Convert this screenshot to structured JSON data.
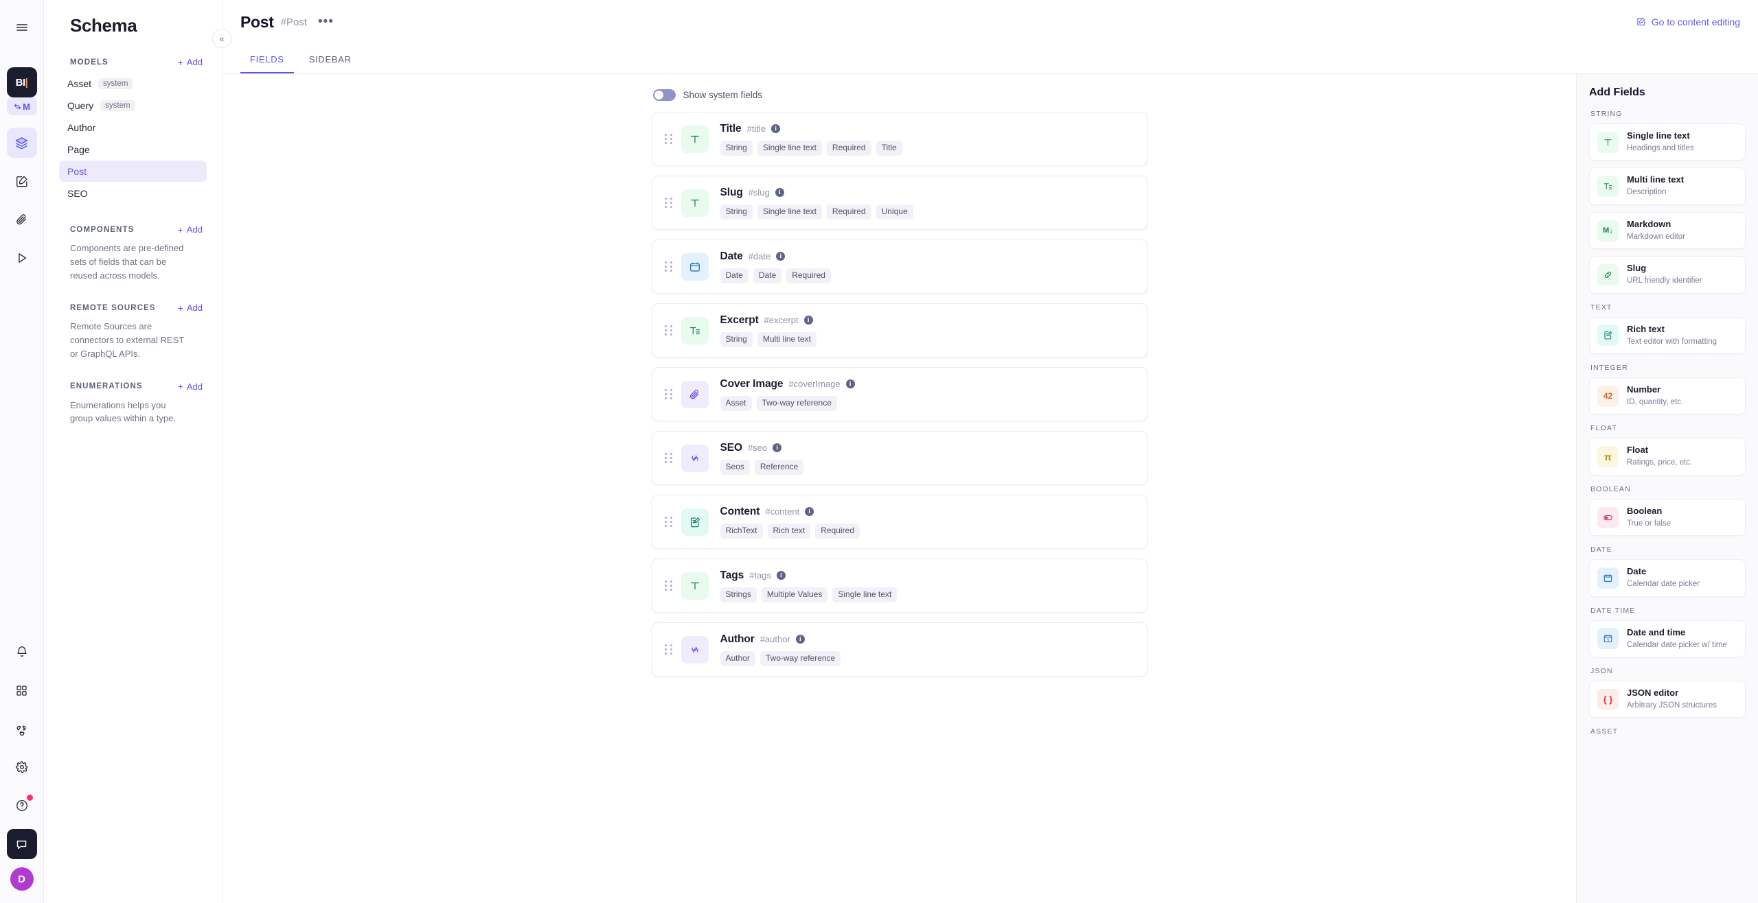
{
  "rail": {
    "menu_icon": "hamburger-menu-icon",
    "logo_text": "BI",
    "project_text": "M",
    "items": [
      {
        "name": "layers-icon",
        "active": true
      },
      {
        "name": "edit-square-icon",
        "active": false
      },
      {
        "name": "paperclip-icon",
        "active": false
      },
      {
        "name": "play-triangle-icon",
        "active": false
      }
    ],
    "bottom_items": [
      {
        "name": "bell-icon"
      },
      {
        "name": "grid-apps-icon"
      },
      {
        "name": "webhook-icon"
      },
      {
        "name": "gear-icon"
      },
      {
        "name": "help-circle-icon",
        "badge": true
      },
      {
        "name": "chat-bubble-icon",
        "dark": true
      }
    ],
    "avatar_initial": "D"
  },
  "sidebar": {
    "title": "Schema",
    "collapse_icon": "chevrons-left-icon",
    "models": {
      "heading": "MODELS",
      "add_label": "Add",
      "items": [
        {
          "label": "Asset",
          "badge": "system",
          "active": false
        },
        {
          "label": "Query",
          "badge": "system",
          "active": false
        },
        {
          "label": "Author",
          "badge": "",
          "active": false
        },
        {
          "label": "Page",
          "badge": "",
          "active": false
        },
        {
          "label": "Post",
          "badge": "",
          "active": true
        },
        {
          "label": "SEO",
          "badge": "",
          "active": false
        }
      ]
    },
    "components": {
      "heading": "COMPONENTS",
      "add_label": "Add",
      "description": "Components are pre-defined sets of fields that can be reused across models."
    },
    "remote_sources": {
      "heading": "REMOTE SOURCES",
      "add_label": "Add",
      "description": "Remote Sources are connectors to external REST or GraphQL APIs."
    },
    "enumerations": {
      "heading": "ENUMERATIONS",
      "add_label": "Add",
      "description": "Enumerations helps you group values within a type."
    }
  },
  "header": {
    "title": "Post",
    "api_id": "#Post",
    "more_label": "•••",
    "goto_label": "Go to content editing",
    "goto_icon": "edit-square-icon"
  },
  "tabs": [
    {
      "label": "FIELDS",
      "active": true
    },
    {
      "label": "SIDEBAR",
      "active": false
    }
  ],
  "main": {
    "show_system_fields_label": "Show system fields",
    "show_system_fields_on": false,
    "fields": [
      {
        "name": "Title",
        "api": "#title",
        "icon": "text-single-line-icon",
        "tone": "green",
        "chips": [
          "String",
          "Single line text",
          "Required",
          "Title"
        ]
      },
      {
        "name": "Slug",
        "api": "#slug",
        "icon": "text-single-line-icon",
        "tone": "green",
        "chips": [
          "String",
          "Single line text",
          "Required",
          "Unique"
        ]
      },
      {
        "name": "Date",
        "api": "#date",
        "icon": "calendar-icon",
        "tone": "blue",
        "chips": [
          "Date",
          "Date",
          "Required"
        ]
      },
      {
        "name": "Excerpt",
        "api": "#excerpt",
        "icon": "text-multi-line-icon",
        "tone": "green",
        "chips": [
          "String",
          "Multi line text"
        ]
      },
      {
        "name": "Cover Image",
        "api": "#coverImage",
        "icon": "paperclip-icon",
        "tone": "violet",
        "chips": [
          "Asset",
          "Two-way reference"
        ]
      },
      {
        "name": "SEO",
        "api": "#seo",
        "icon": "link-chain-icon",
        "tone": "violet",
        "chips": [
          "Seos",
          "Reference"
        ]
      },
      {
        "name": "Content",
        "api": "#content",
        "icon": "rich-text-icon",
        "tone": "teal",
        "chips": [
          "RichText",
          "Rich text",
          "Required"
        ]
      },
      {
        "name": "Tags",
        "api": "#tags",
        "icon": "text-single-line-icon",
        "tone": "green",
        "chips": [
          "Strings",
          "Multiple Values",
          "Single line text"
        ]
      },
      {
        "name": "Author",
        "api": "#author",
        "icon": "link-chain-icon",
        "tone": "violet",
        "chips": [
          "Author",
          "Two-way reference"
        ]
      }
    ]
  },
  "add_fields": {
    "title": "Add Fields",
    "groups": [
      {
        "label": "STRING",
        "cards": [
          {
            "name": "Single line text",
            "sub": "Headings and titles",
            "icon": "text-single-line-icon",
            "tone": "green",
            "glyph": "T"
          },
          {
            "name": "Multi line text",
            "sub": "Description",
            "icon": "text-multi-line-icon",
            "tone": "green",
            "glyph": "T="
          },
          {
            "name": "Markdown",
            "sub": "Markdown editor",
            "icon": "markdown-icon",
            "tone": "green",
            "glyph": "M↓"
          },
          {
            "name": "Slug",
            "sub": "URL friendly identifier",
            "icon": "link-chain-icon",
            "tone": "green",
            "glyph": "link"
          }
        ]
      },
      {
        "label": "TEXT",
        "cards": [
          {
            "name": "Rich text",
            "sub": "Text editor with formatting",
            "icon": "rich-text-icon",
            "tone": "teal",
            "glyph": "rich"
          }
        ]
      },
      {
        "label": "INTEGER",
        "cards": [
          {
            "name": "Number",
            "sub": "ID, quantity, etc.",
            "icon": "number-42-icon",
            "tone": "orange",
            "glyph": "42"
          }
        ]
      },
      {
        "label": "FLOAT",
        "cards": [
          {
            "name": "Float",
            "sub": "Ratings, price, etc.",
            "icon": "pi-icon",
            "tone": "yellow",
            "glyph": "π"
          }
        ]
      },
      {
        "label": "BOOLEAN",
        "cards": [
          {
            "name": "Boolean",
            "sub": "True or false",
            "icon": "toggle-icon",
            "tone": "pink",
            "glyph": "toggle"
          }
        ]
      },
      {
        "label": "DATE",
        "cards": [
          {
            "name": "Date",
            "sub": "Calendar date picker",
            "icon": "calendar-icon",
            "tone": "blue",
            "glyph": "cal"
          }
        ]
      },
      {
        "label": "DATE TIME",
        "cards": [
          {
            "name": "Date and time",
            "sub": "Calendar date picker w/ time",
            "icon": "calendar-clock-icon",
            "tone": "blue",
            "glyph": "calclock"
          }
        ]
      },
      {
        "label": "JSON",
        "cards": [
          {
            "name": "JSON editor",
            "sub": "Arbitrary JSON structures",
            "icon": "braces-icon",
            "tone": "red",
            "glyph": "{ }"
          }
        ]
      },
      {
        "label": "ASSET",
        "cards": []
      }
    ]
  },
  "colors": {
    "accent": "#5b54e8",
    "accent_soft": "#eceafb",
    "text": "#1b1c2b",
    "muted": "#7a8094",
    "avatar": "#b13ad1",
    "badge": "#ff2d6f"
  }
}
